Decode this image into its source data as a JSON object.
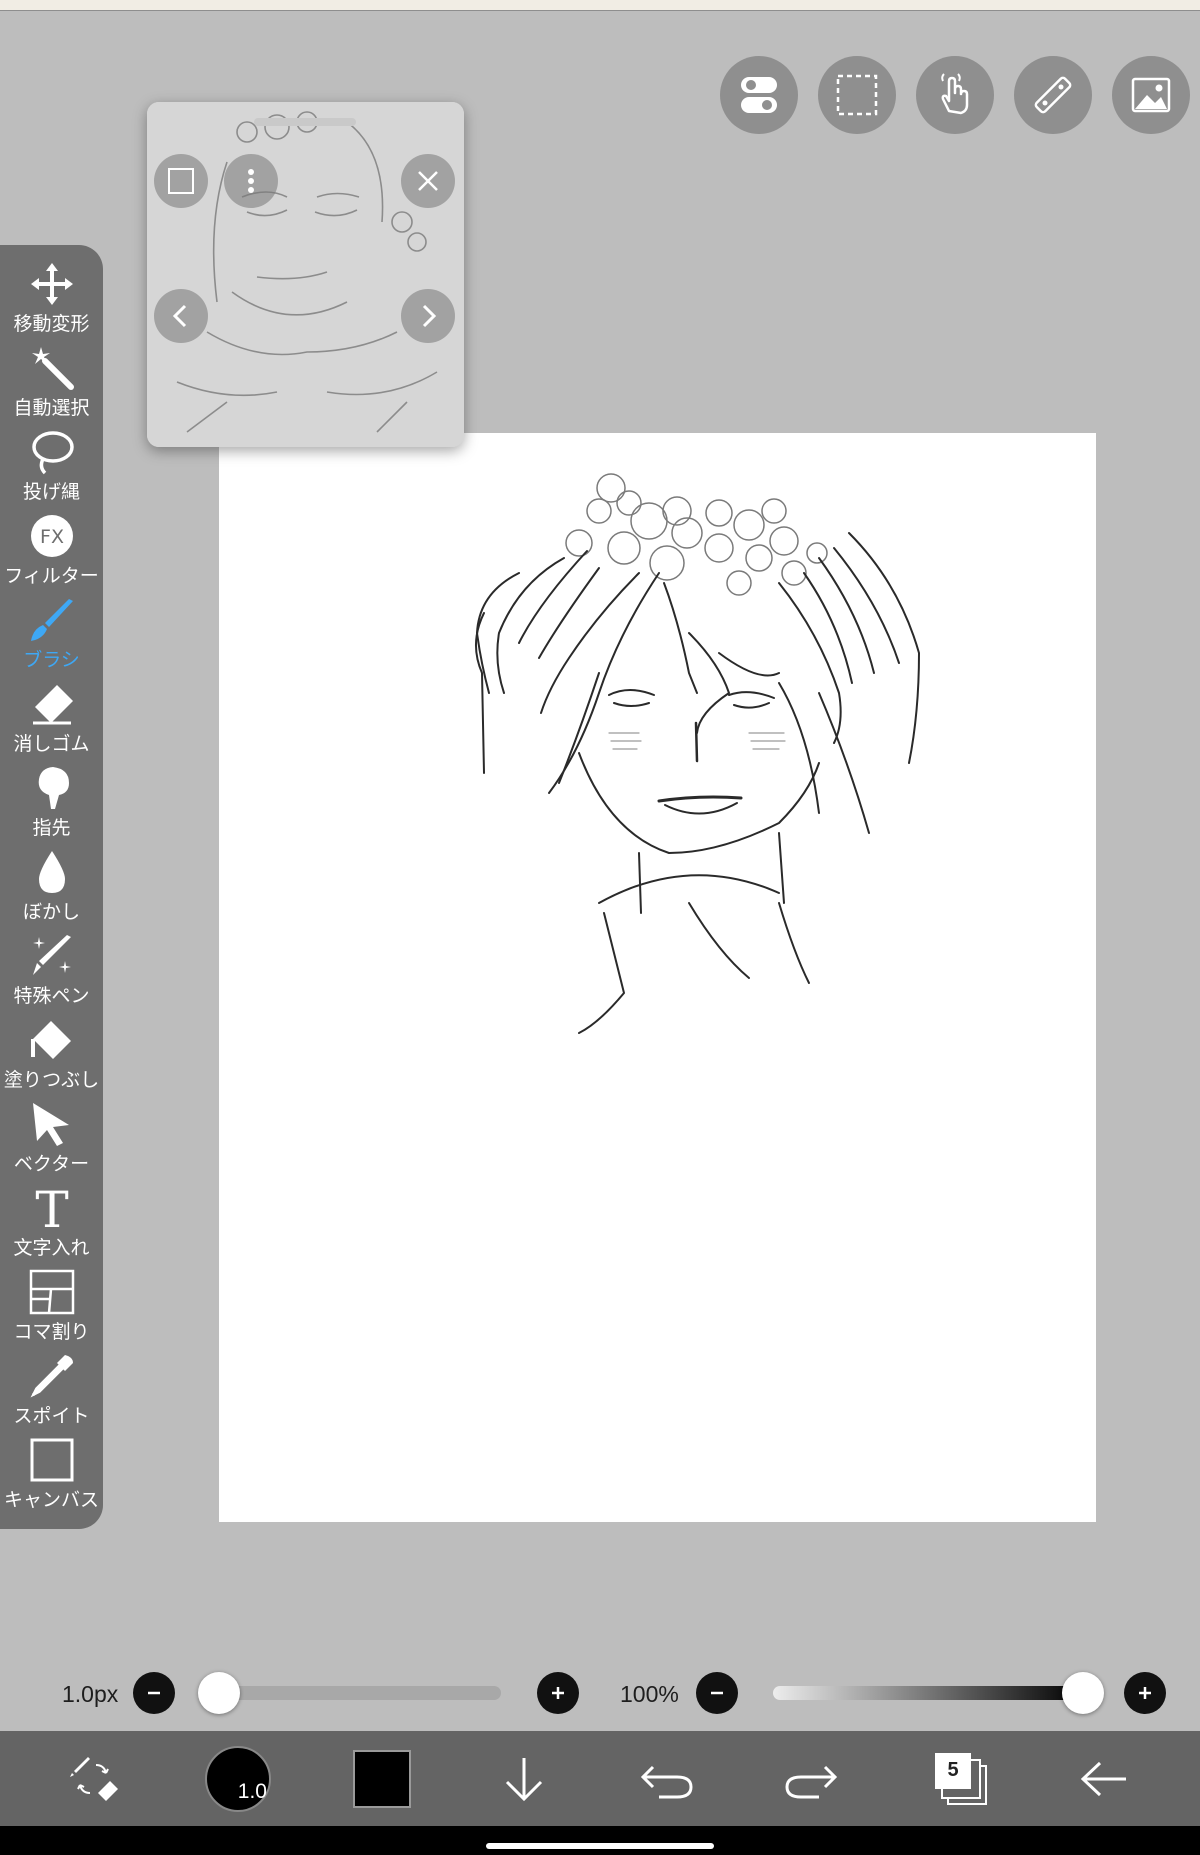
{
  "tools": [
    {
      "label": "移動変形",
      "icon": "move-icon"
    },
    {
      "label": "自動選択",
      "icon": "magic-wand-icon"
    },
    {
      "label": "投げ縄",
      "icon": "lasso-icon"
    },
    {
      "label": "フィルター",
      "icon": "filter-fx-icon",
      "glyph": "FX"
    },
    {
      "label": "ブラシ",
      "icon": "brush-icon"
    },
    {
      "label": "消しゴム",
      "icon": "eraser-icon"
    },
    {
      "label": "指先",
      "icon": "finger-smudge-icon"
    },
    {
      "label": "ぼかし",
      "icon": "blur-drop-icon"
    },
    {
      "label": "特殊ペン",
      "icon": "special-pen-icon"
    },
    {
      "label": "塗りつぶし",
      "icon": "fill-bucket-icon"
    },
    {
      "label": "ベクター",
      "icon": "vector-arrow-icon"
    },
    {
      "label": "文字入れ",
      "icon": "text-icon",
      "glyph": "T"
    },
    {
      "label": "コマ割り",
      "icon": "frame-division-icon"
    },
    {
      "label": "スポイト",
      "icon": "eyedropper-icon"
    },
    {
      "label": "キャンバス",
      "icon": "canvas-icon"
    }
  ],
  "active_tool": "ブラシ",
  "top_buttons": [
    "toggle-icon",
    "selection-icon",
    "hand-icon",
    "ruler-icon",
    "material-image-icon"
  ],
  "brush": {
    "size_label": "1.0px",
    "size_value": 1.0,
    "size_slider_fraction": 0.0,
    "opacity_label": "100%",
    "opacity_fraction": 1.0
  },
  "bottom": {
    "brush_size_badge": "1.0",
    "layer_count": "5",
    "primary_color": "#000000"
  },
  "colors": {
    "accent": "#3ea8f5",
    "toolbar": "#6e6e6e",
    "bottom_bar": "#646464",
    "background": "#bdbdbd"
  }
}
